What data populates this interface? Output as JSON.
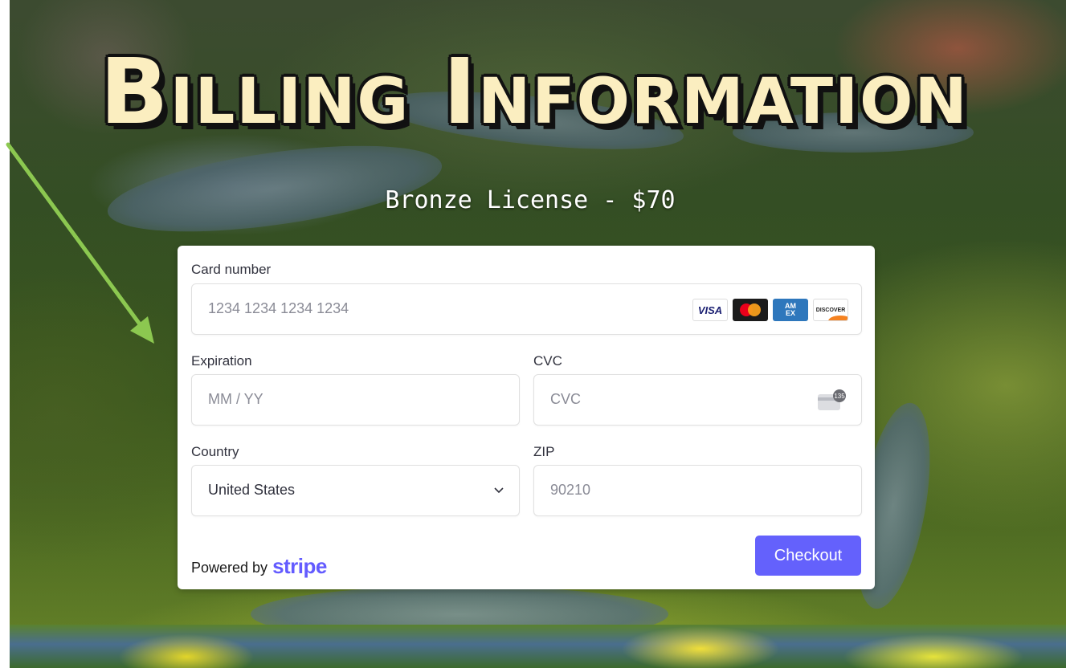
{
  "page": {
    "title": "Billing Information",
    "subtitle": "Bronze License - $70"
  },
  "form": {
    "card_number": {
      "label": "Card number",
      "placeholder": "1234 1234 1234 1234"
    },
    "card_brands": [
      "VISA",
      "Mastercard",
      "AMEX",
      "DISCOVER"
    ],
    "expiration": {
      "label": "Expiration",
      "placeholder": "MM / YY"
    },
    "cvc": {
      "label": "CVC",
      "placeholder": "CVC",
      "icon_badge": "135"
    },
    "country": {
      "label": "Country",
      "value": "United States"
    },
    "zip": {
      "label": "ZIP",
      "placeholder": "90210"
    }
  },
  "footer": {
    "powered_by": "Powered by",
    "brand": "stripe",
    "checkout_label": "Checkout"
  },
  "colors": {
    "accent": "#6461fc",
    "stripe_brand": "#635bff",
    "arrow": "#8cc850",
    "title": "#fbeec0"
  },
  "icons": {
    "arrow": "arrow-pointer-icon",
    "cvc": "card-back-icon",
    "dropdown": "chevron-down-icon"
  }
}
